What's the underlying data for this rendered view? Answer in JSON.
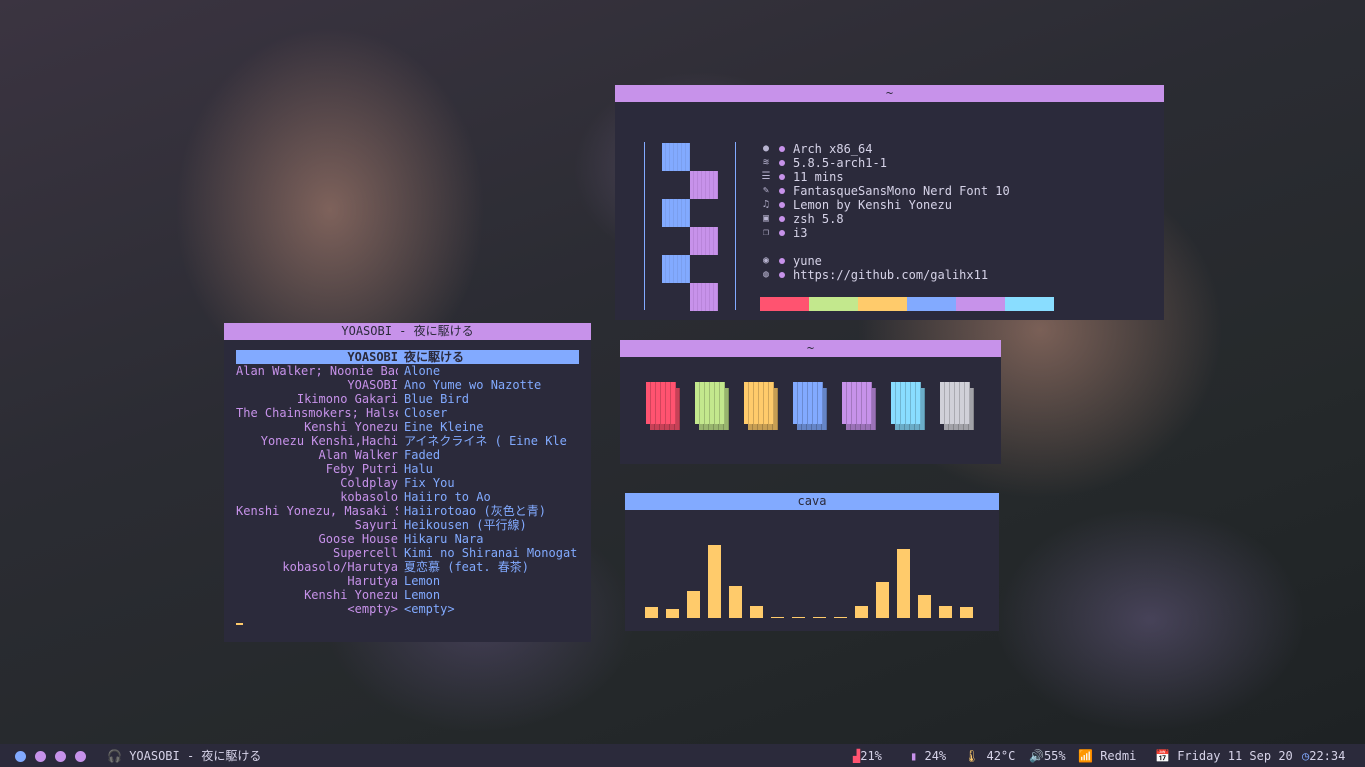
{
  "neofetch": {
    "title": "~",
    "info": [
      {
        "icon": "penguin-icon",
        "text": "Arch x86_64"
      },
      {
        "icon": "layers-icon",
        "text": "5.8.5-arch1-1"
      },
      {
        "icon": "uptime-icon",
        "text": "11 mins"
      },
      {
        "icon": "pencil-icon",
        "text": "FantasqueSansMono Nerd Font 10"
      },
      {
        "icon": "music-note-icon",
        "text": "Lemon by Kenshi Yonezu"
      },
      {
        "icon": "terminal-icon",
        "text": "zsh 5.8"
      },
      {
        "icon": "windows-icon",
        "text": "i3"
      },
      {
        "icon": "",
        "text": ""
      },
      {
        "icon": "user-icon",
        "text": "yune"
      },
      {
        "icon": "github-icon",
        "text": "https://github.com/galihx11"
      }
    ],
    "palette": [
      "#ff5370",
      "#c3e88d",
      "#ffcb6b",
      "#82aaff",
      "#c792ea",
      "#89ddff"
    ]
  },
  "player": {
    "title": "YOASOBI - 夜に駆ける",
    "tracks": [
      {
        "artist": "YOASOBI",
        "title": "夜に駆ける",
        "selected": true
      },
      {
        "artist": "Alan Walker; Noonie Bao",
        "title": "Alone"
      },
      {
        "artist": "YOASOBI",
        "title": "Ano Yume wo Nazotte"
      },
      {
        "artist": "Ikimono Gakari",
        "title": "Blue Bird"
      },
      {
        "artist": "The Chainsmokers; Halse",
        "title": "Closer"
      },
      {
        "artist": "Kenshi Yonezu",
        "title": "Eine Kleine"
      },
      {
        "artist": "Yonezu Kenshi,Hachi",
        "title": "アイネクライネ ( Eine Kle"
      },
      {
        "artist": "Alan Walker",
        "title": "Faded"
      },
      {
        "artist": "Feby Putri",
        "title": "Halu"
      },
      {
        "artist": "Coldplay",
        "title": "Fix You"
      },
      {
        "artist": "kobasolo",
        "title": "Haiiro to Ao"
      },
      {
        "artist": "Kenshi Yonezu, Masaki S",
        "title": "Haiirotoao (灰色と青)"
      },
      {
        "artist": "Sayuri",
        "title": "Heikousen (平行線)"
      },
      {
        "artist": "Goose House",
        "title": "Hikaru Nara"
      },
      {
        "artist": "Supercell",
        "title": "Kimi no Shiranai Monogata"
      },
      {
        "artist": "kobasolo/Harutya",
        "title": "夏恋慕 (feat. 春茶)"
      },
      {
        "artist": "Harutya",
        "title": "Lemon"
      },
      {
        "artist": "Kenshi Yonezu",
        "title": "Lemon"
      },
      {
        "artist": "<empty>",
        "title": "<empty>"
      }
    ]
  },
  "colors": {
    "title": "~",
    "swatches": [
      "#ff5370",
      "#c3e88d",
      "#ffcb6b",
      "#82aaff",
      "#c792ea",
      "#89ddff",
      "#d0d0d8"
    ]
  },
  "cava": {
    "title": "cava",
    "levels": [
      0.15,
      0.12,
      0.35,
      0.96,
      0.42,
      0.16,
      0.01,
      0.01,
      0.01,
      0.01,
      0.16,
      0.47,
      0.91,
      0.3,
      0.16,
      0.15
    ],
    "color": "#ffcb6b"
  },
  "statusbar": {
    "workspaces": [
      "#82aaff",
      "#c792ea",
      "#c792ea",
      "#c792ea"
    ],
    "now_playing": "YOASOBI - 夜に駆ける",
    "cpu": "21%",
    "memory": "24%",
    "temperature": "42°C",
    "volume": "55%",
    "wifi": "Redmi",
    "date": "Friday 11 Sep 20",
    "time": "22:34"
  }
}
